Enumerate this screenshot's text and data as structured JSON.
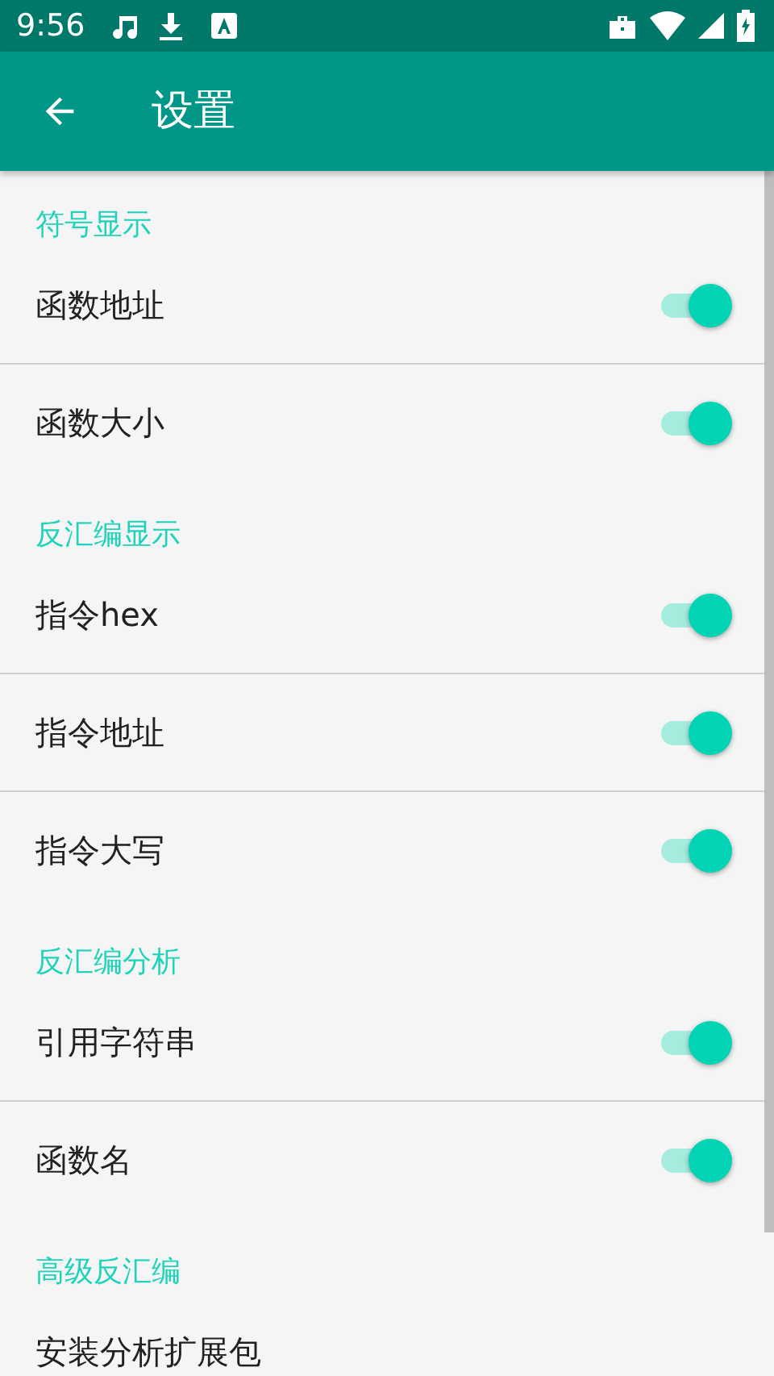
{
  "status_bar": {
    "time": "9:56"
  },
  "app_bar": {
    "title": "设置"
  },
  "sections": [
    {
      "title": "符号显示",
      "items": [
        {
          "label": "函数地址",
          "on": true
        },
        {
          "label": "函数大小",
          "on": true
        }
      ]
    },
    {
      "title": "反汇编显示",
      "items": [
        {
          "label": "指令hex",
          "on": true
        },
        {
          "label": "指令地址",
          "on": true
        },
        {
          "label": "指令大写",
          "on": true
        }
      ]
    },
    {
      "title": "反汇编分析",
      "items": [
        {
          "label": "引用字符串",
          "on": true
        },
        {
          "label": "函数名",
          "on": true
        }
      ]
    },
    {
      "title": "高级反汇编",
      "items": [
        {
          "label": "安装分析扩展包",
          "kind": "plain"
        }
      ]
    }
  ]
}
